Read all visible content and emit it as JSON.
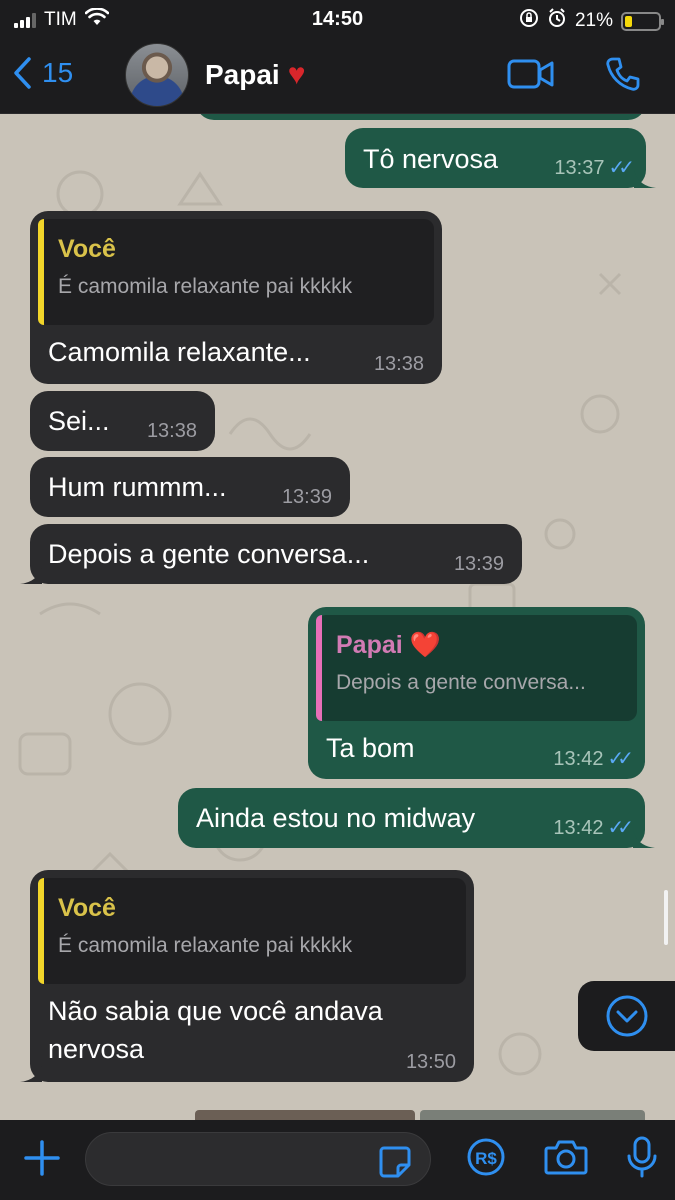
{
  "status_bar": {
    "carrier": "TIM",
    "time": "14:50",
    "battery": "21%",
    "battery_level": 0.21
  },
  "header": {
    "back_count": "15",
    "contact_name": "Papai",
    "contact_emoji": "❤️",
    "icons": [
      "chevron-left-icon",
      "video-call-icon",
      "phone-icon"
    ]
  },
  "messages": [
    {
      "direction": "out",
      "text": "Tô nervosa",
      "time": "13:37",
      "status": "read"
    },
    {
      "direction": "in",
      "quote_author": "Você",
      "quote_text": "É camomila relaxante pai kkkkk",
      "text": "Camomila relaxante...",
      "time": "13:38"
    },
    {
      "direction": "in",
      "text": "Sei...",
      "time": "13:38"
    },
    {
      "direction": "in",
      "text": "Hum rummm...",
      "time": "13:39"
    },
    {
      "direction": "in",
      "text": "Depois a gente conversa...",
      "time": "13:39"
    },
    {
      "direction": "out",
      "quote_author": "Papai ❤️",
      "quote_text": "Depois a gente conversa...",
      "text": "Ta bom",
      "time": "13:42",
      "status": "read"
    },
    {
      "direction": "out",
      "text": "Ainda estou no midway",
      "time": "13:42",
      "status": "read"
    },
    {
      "direction": "in",
      "quote_author": "Você",
      "quote_text": "É camomila relaxante pai kkkkk",
      "text_line1": "Não sabia que você andava",
      "text_line2": "nervosa",
      "time": "13:50"
    }
  ],
  "input_bar": {
    "placeholder": "",
    "icons": [
      "plus-icon",
      "sticker-icon",
      "pix-icon",
      "camera-icon",
      "microphone-icon"
    ]
  },
  "colors": {
    "accent": "#2f8ff0",
    "incoming_bubble": "#2b2b2d",
    "outgoing_bubble": "#1f5846",
    "wallpaper": "#c9c3b8",
    "read_check": "#5aa9f5"
  }
}
